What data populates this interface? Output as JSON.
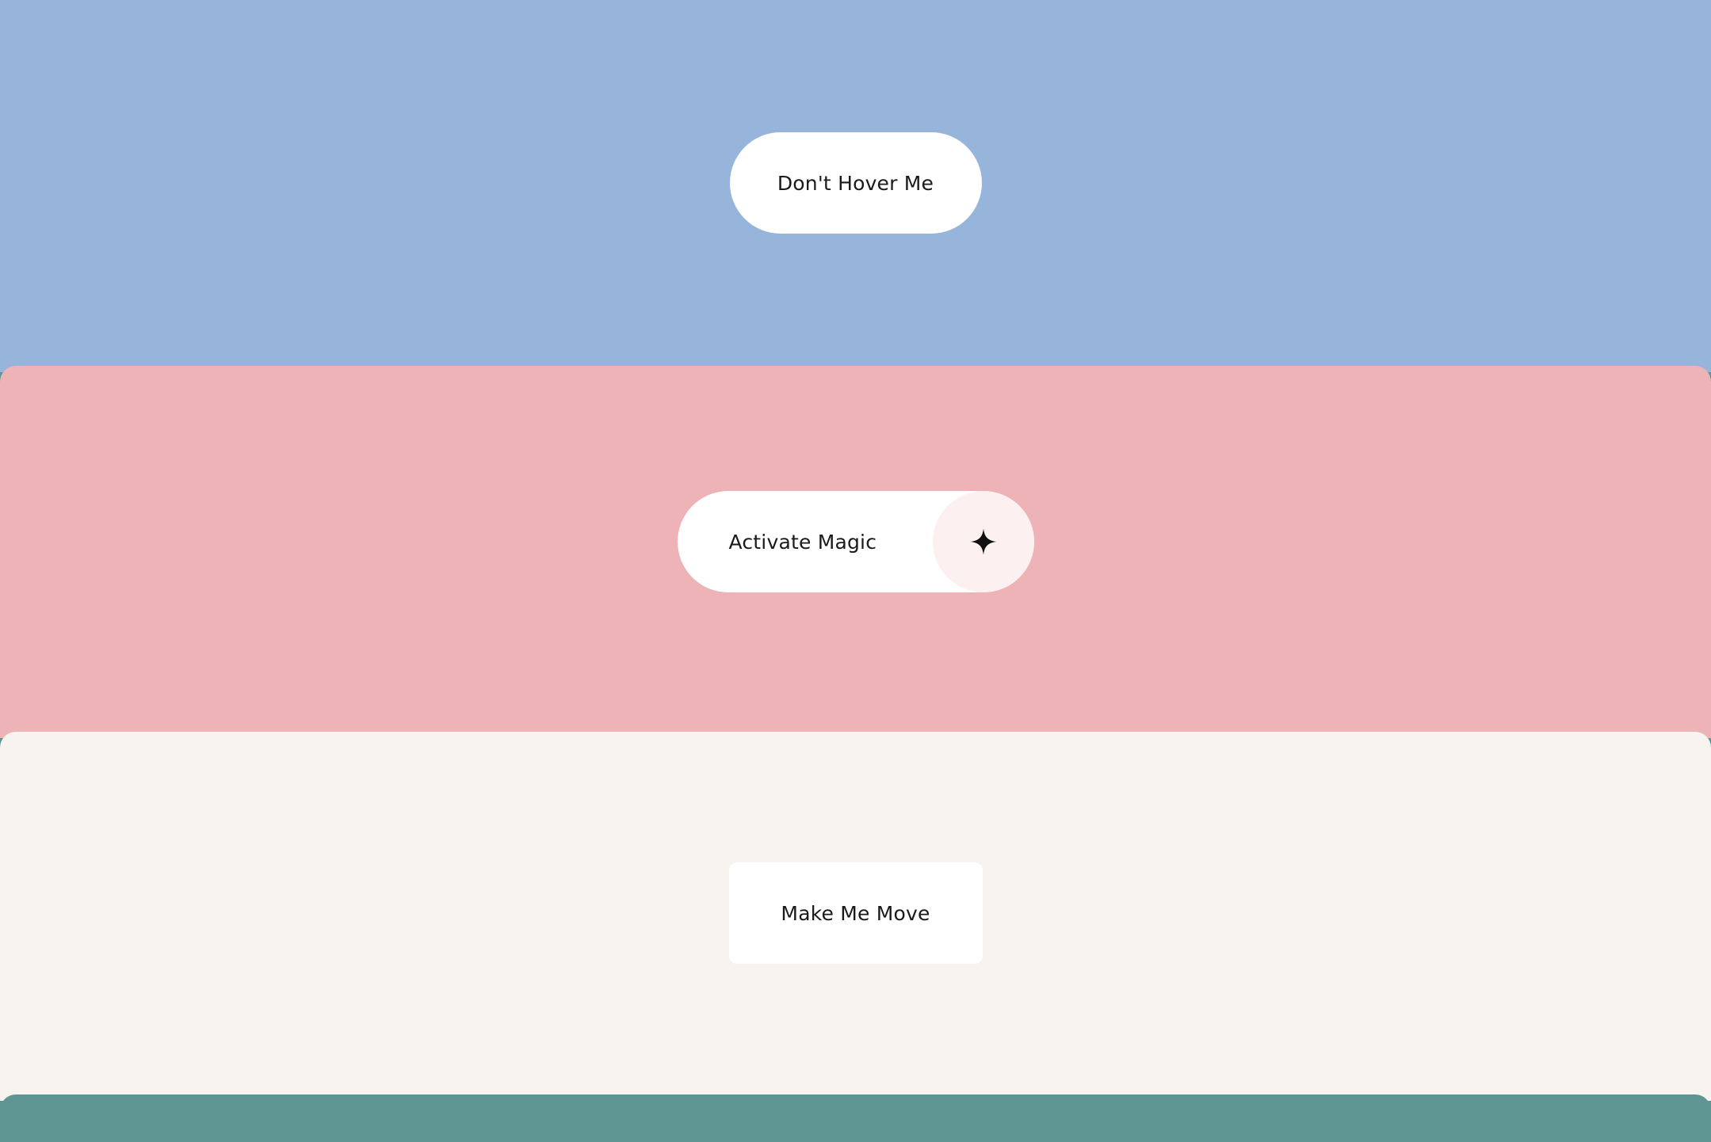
{
  "sections": {
    "hover": {
      "background": "#97b4da",
      "button_label": "Don't Hover Me"
    },
    "magic": {
      "background": "#edb3b7",
      "button_label": "Activate Magic",
      "icon": "sparkle-icon"
    },
    "move": {
      "background": "#f7f4ef",
      "button_label": "Make Me Move"
    },
    "next": {
      "background": "#5f9593"
    }
  }
}
